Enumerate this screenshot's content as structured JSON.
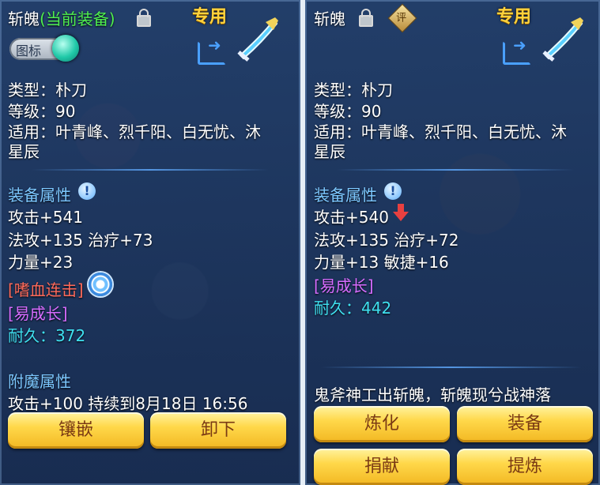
{
  "left": {
    "name": "斩魄",
    "equipped_tag": "(当前装备)",
    "exclusive": "专用",
    "toggle_label": "图标",
    "type": "类型：朴刀",
    "level": "等级：90",
    "suitable_line1": "适用：叶青峰、烈千阳、白无忧、沐",
    "suitable_line2": "星辰",
    "attr_title": "装备属性",
    "attack": "攻击+541",
    "magic_heal": "法攻+135 治疗+73",
    "strength": "力量+23",
    "skill": "[嗜血连击]",
    "growth": "[易成长]",
    "durability_label": "耐久：",
    "durability_value": "372",
    "enchant_title": "附魔属性",
    "enchant_value": "攻击+100 持续到8月18日 16:56",
    "btn_inlay": "镶嵌",
    "btn_unequip": "卸下"
  },
  "right": {
    "name": "斩魄",
    "eval_badge": "评",
    "exclusive": "专用",
    "type": "类型：朴刀",
    "level": "等级：90",
    "suitable_line1": "适用：叶青峰、烈千阳、白无忧、沐",
    "suitable_line2": "星辰",
    "attr_title": "装备属性",
    "attack": "攻击+540",
    "magic_heal": "法攻+135 治疗+72",
    "strength_agility": "力量+13 敏捷+16",
    "growth": "[易成长]",
    "durability_label": "耐久：",
    "durability_value": "442",
    "flavor": "鬼斧神工出斩魄，斩魄现兮战神落",
    "btn_refine": "炼化",
    "btn_equip": "装备",
    "btn_donate": "捐献",
    "btn_extract": "提炼"
  },
  "icons": [
    "lock-icon",
    "info-icon",
    "share-icon",
    "weapon-icon",
    "skill-swirl-icon",
    "evaluate-icon",
    "down-arrow-icon"
  ],
  "colors": {
    "button": "#ffd84a",
    "equipped": "#4ff04f",
    "skill": "#ff6a5a",
    "growth": "#d66cff",
    "durability": "#3fe0f0",
    "exclusive": "#ffd23c"
  }
}
